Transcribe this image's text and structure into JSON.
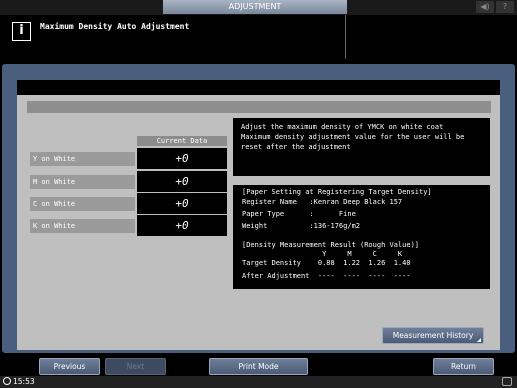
{
  "topbar": {
    "tab_label": "ADJUSTMENT",
    "speaker_icon": "speaker-icon",
    "help_label": "?"
  },
  "header": {
    "info_glyph": "i",
    "title": "Maximum Density Auto Adjustment"
  },
  "table": {
    "column_header": "Current Data",
    "rows": [
      {
        "label": "Y on White",
        "value": "+0"
      },
      {
        "label": "M on White",
        "value": "+0"
      },
      {
        "label": "C on White",
        "value": "+0"
      },
      {
        "label": "K on White",
        "value": "+0"
      }
    ]
  },
  "message": {
    "line1": "Adjust the maximum density of YMCK on white coat",
    "line2": "Maximum density adjustment value for the user will be",
    "line3": "reset after the adjustment"
  },
  "target": {
    "heading": "[Paper Setting at Registering Target Density]",
    "register_name": "Register Name   :Kenran Deep Black 157",
    "paper_type": "Paper Type      :      Fine",
    "weight": "Weight          :136-176g/m2",
    "measure_heading": "[Density Measurement Result (Rough Value)]",
    "measure_cols": "                   Y     M     C     K",
    "target_density": "Target Density    0.88  1.22  1.26  1.40",
    "after_adjustment": "After Adjustment  ----  ----  ----  ----"
  },
  "buttons": {
    "measurement_history": "Measurement History",
    "previous": "Previous",
    "next": "Next",
    "print_mode": "Print Mode",
    "return": "Return"
  },
  "status": {
    "time": "15:53"
  }
}
